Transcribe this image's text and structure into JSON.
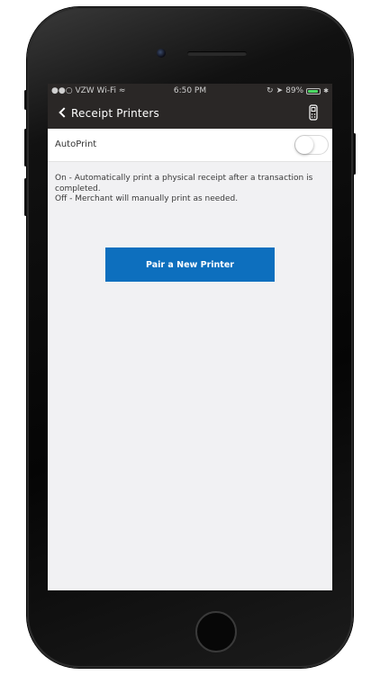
{
  "status_bar": {
    "carrier": "VZW Wi-Fi",
    "time": "6:50 PM",
    "battery_percent": "89%",
    "battery_level": 0.89,
    "battery_color": "#4cd964"
  },
  "nav": {
    "back_icon": "chevron-left-icon",
    "title": "Receipt Printers",
    "right_icon": "card-reader-icon"
  },
  "autoprint": {
    "label": "AutoPrint",
    "enabled": false
  },
  "description": {
    "on_text": "On - Automatically print a physical receipt after a transaction is completed.",
    "off_text": "Off -  Merchant will manually print as needed."
  },
  "actions": {
    "pair_label": "Pair a New Printer",
    "pair_color": "#0d6fbe"
  },
  "theme": {
    "navbar_bg": "#2a2726",
    "screen_bg": "#f1f1f3"
  }
}
